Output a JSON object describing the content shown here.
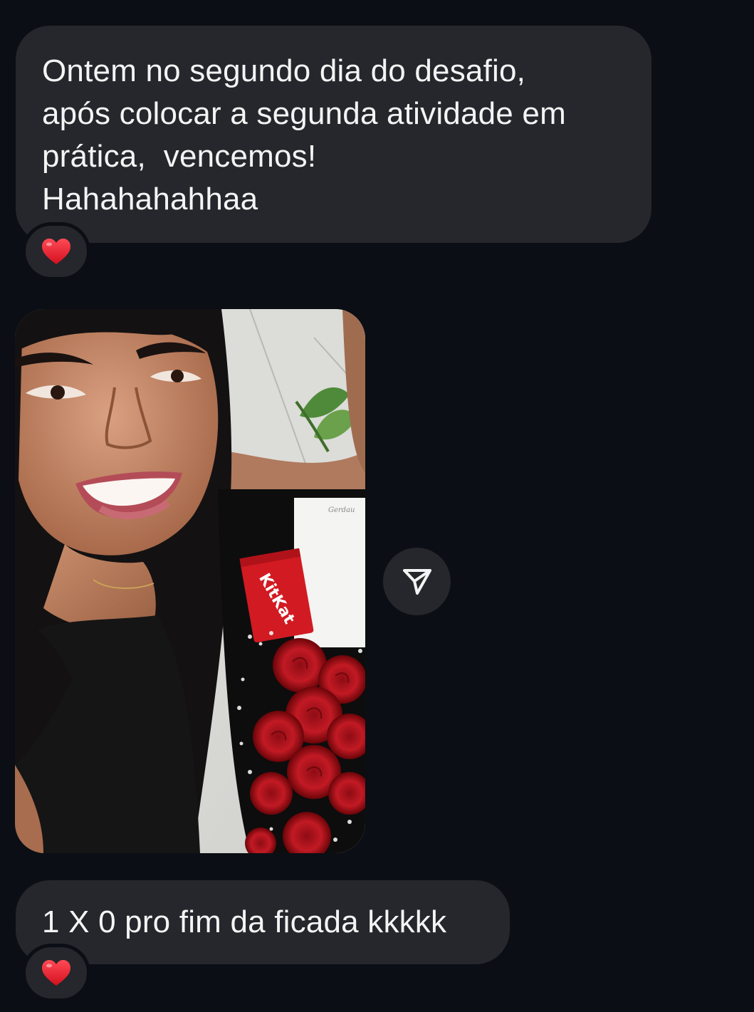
{
  "messages": [
    {
      "lines": [
        "Ontem no segundo dia do desafio,",
        "após colocar a segunda atividade em",
        "prática,  vencemos!",
        "Hahahahahhaa"
      ],
      "reaction": "heart-icon"
    },
    {
      "photo": "selfie-with-kitkat-and-roses",
      "photo_text": "KitKat",
      "action": "share-icon"
    },
    {
      "text": "1 X 0 pro fim da ficada kkkkk",
      "reaction": "heart-icon"
    }
  ],
  "colors": {
    "background": "#0b0e14",
    "bubble": "#25272c",
    "text": "#f4f4f4",
    "heart": "#e8202f"
  }
}
